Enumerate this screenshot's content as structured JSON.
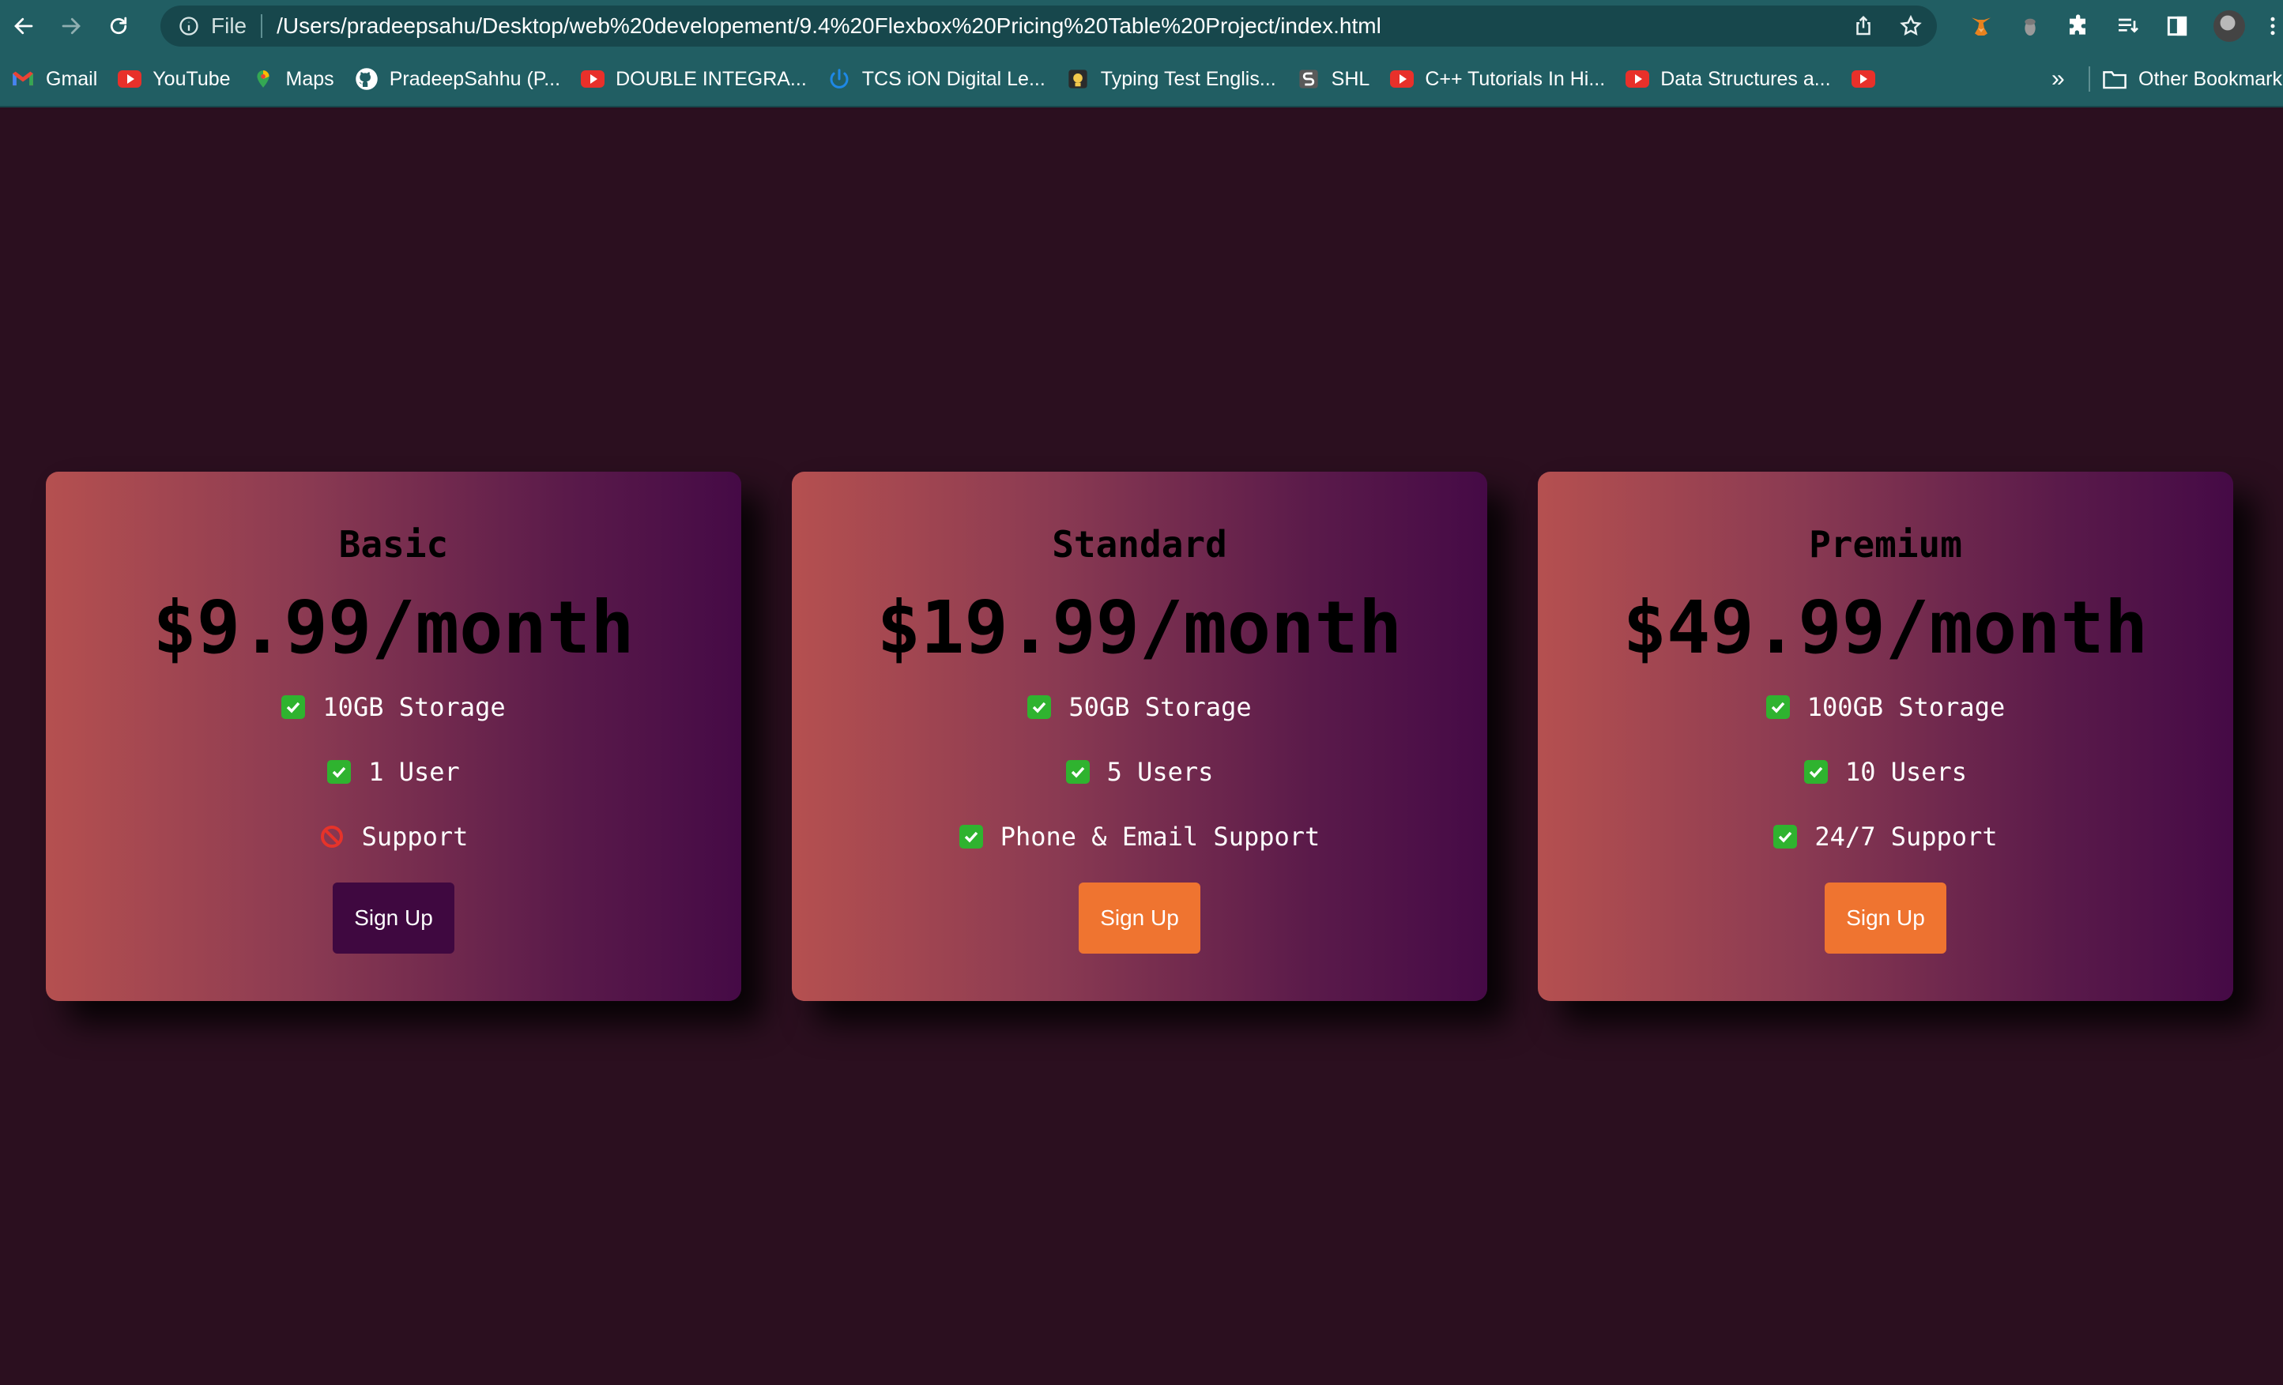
{
  "browser": {
    "file_label": "File",
    "url": "/Users/pradeepsahu/Desktop/web%20developement/9.4%20Flexbox%20Pricing%20Table%20Project/index.html"
  },
  "bookmarks": [
    {
      "label": "Gmail",
      "icon": "gmail-icon"
    },
    {
      "label": "YouTube",
      "icon": "youtube-icon"
    },
    {
      "label": "Maps",
      "icon": "maps-icon"
    },
    {
      "label": "PradeepSahhu (P...",
      "icon": "github-icon"
    },
    {
      "label": "DOUBLE INTEGRA...",
      "icon": "youtube-icon"
    },
    {
      "label": "TCS iON Digital Le...",
      "icon": "power-icon"
    },
    {
      "label": "Typing Test Englis...",
      "icon": "typing-icon"
    },
    {
      "label": "SHL",
      "icon": "shl-icon"
    },
    {
      "label": "C++ Tutorials In Hi...",
      "icon": "youtube-icon"
    },
    {
      "label": "Data Structures a...",
      "icon": "youtube-icon"
    }
  ],
  "bookmarks_more": "»",
  "other_bookmarks": "Other Bookmark",
  "plans": [
    {
      "name": "Basic",
      "price": "$9.99/month",
      "features": [
        {
          "icon": "check-icon",
          "text": "10GB Storage"
        },
        {
          "icon": "check-icon",
          "text": "1 User"
        },
        {
          "icon": "no-entry-icon",
          "text": "Support"
        }
      ],
      "button": "Sign Up",
      "button_color": "#3f0840"
    },
    {
      "name": "Standard",
      "price": "$19.99/month",
      "features": [
        {
          "icon": "check-icon",
          "text": "50GB Storage"
        },
        {
          "icon": "check-icon",
          "text": "5 Users"
        },
        {
          "icon": "check-icon",
          "text": "Phone & Email Support"
        }
      ],
      "button": "Sign Up",
      "button_color": "#ef7430"
    },
    {
      "name": "Premium",
      "price": "$49.99/month",
      "features": [
        {
          "icon": "check-icon",
          "text": "100GB Storage"
        },
        {
          "icon": "check-icon",
          "text": "10 Users"
        },
        {
          "icon": "check-icon",
          "text": "24/7 Support"
        }
      ],
      "button": "Sign Up",
      "button_color": "#ef7430"
    }
  ],
  "colors": {
    "page_background": "#2b0f1f",
    "browser_chrome": "#215e63",
    "card_gradient_start": "#b55050",
    "card_gradient_end": "#450a46",
    "check_green": "#2fb32f"
  }
}
